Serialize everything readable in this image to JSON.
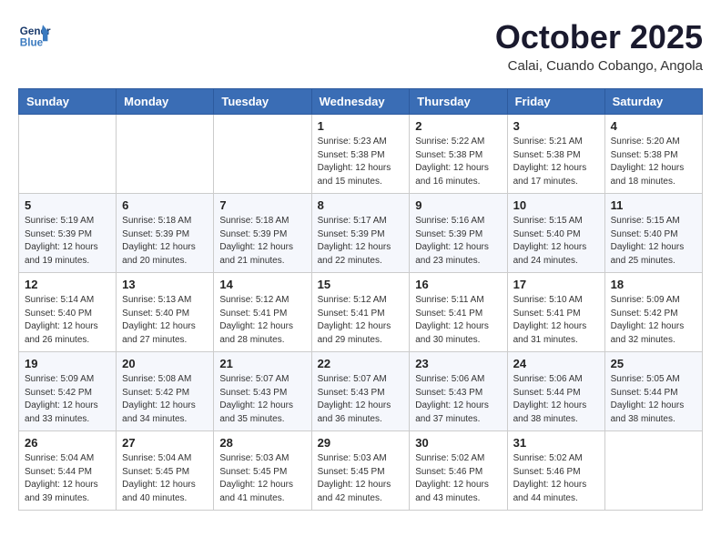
{
  "header": {
    "logo_line1": "General",
    "logo_line2": "Blue",
    "month": "October 2025",
    "location": "Calai, Cuando Cobango, Angola"
  },
  "weekdays": [
    "Sunday",
    "Monday",
    "Tuesday",
    "Wednesday",
    "Thursday",
    "Friday",
    "Saturday"
  ],
  "weeks": [
    [
      {
        "day": "",
        "sunrise": "",
        "sunset": "",
        "daylight": ""
      },
      {
        "day": "",
        "sunrise": "",
        "sunset": "",
        "daylight": ""
      },
      {
        "day": "",
        "sunrise": "",
        "sunset": "",
        "daylight": ""
      },
      {
        "day": "1",
        "sunrise": "Sunrise: 5:23 AM",
        "sunset": "Sunset: 5:38 PM",
        "daylight": "Daylight: 12 hours and 15 minutes."
      },
      {
        "day": "2",
        "sunrise": "Sunrise: 5:22 AM",
        "sunset": "Sunset: 5:38 PM",
        "daylight": "Daylight: 12 hours and 16 minutes."
      },
      {
        "day": "3",
        "sunrise": "Sunrise: 5:21 AM",
        "sunset": "Sunset: 5:38 PM",
        "daylight": "Daylight: 12 hours and 17 minutes."
      },
      {
        "day": "4",
        "sunrise": "Sunrise: 5:20 AM",
        "sunset": "Sunset: 5:38 PM",
        "daylight": "Daylight: 12 hours and 18 minutes."
      }
    ],
    [
      {
        "day": "5",
        "sunrise": "Sunrise: 5:19 AM",
        "sunset": "Sunset: 5:39 PM",
        "daylight": "Daylight: 12 hours and 19 minutes."
      },
      {
        "day": "6",
        "sunrise": "Sunrise: 5:18 AM",
        "sunset": "Sunset: 5:39 PM",
        "daylight": "Daylight: 12 hours and 20 minutes."
      },
      {
        "day": "7",
        "sunrise": "Sunrise: 5:18 AM",
        "sunset": "Sunset: 5:39 PM",
        "daylight": "Daylight: 12 hours and 21 minutes."
      },
      {
        "day": "8",
        "sunrise": "Sunrise: 5:17 AM",
        "sunset": "Sunset: 5:39 PM",
        "daylight": "Daylight: 12 hours and 22 minutes."
      },
      {
        "day": "9",
        "sunrise": "Sunrise: 5:16 AM",
        "sunset": "Sunset: 5:39 PM",
        "daylight": "Daylight: 12 hours and 23 minutes."
      },
      {
        "day": "10",
        "sunrise": "Sunrise: 5:15 AM",
        "sunset": "Sunset: 5:40 PM",
        "daylight": "Daylight: 12 hours and 24 minutes."
      },
      {
        "day": "11",
        "sunrise": "Sunrise: 5:15 AM",
        "sunset": "Sunset: 5:40 PM",
        "daylight": "Daylight: 12 hours and 25 minutes."
      }
    ],
    [
      {
        "day": "12",
        "sunrise": "Sunrise: 5:14 AM",
        "sunset": "Sunset: 5:40 PM",
        "daylight": "Daylight: 12 hours and 26 minutes."
      },
      {
        "day": "13",
        "sunrise": "Sunrise: 5:13 AM",
        "sunset": "Sunset: 5:40 PM",
        "daylight": "Daylight: 12 hours and 27 minutes."
      },
      {
        "day": "14",
        "sunrise": "Sunrise: 5:12 AM",
        "sunset": "Sunset: 5:41 PM",
        "daylight": "Daylight: 12 hours and 28 minutes."
      },
      {
        "day": "15",
        "sunrise": "Sunrise: 5:12 AM",
        "sunset": "Sunset: 5:41 PM",
        "daylight": "Daylight: 12 hours and 29 minutes."
      },
      {
        "day": "16",
        "sunrise": "Sunrise: 5:11 AM",
        "sunset": "Sunset: 5:41 PM",
        "daylight": "Daylight: 12 hours and 30 minutes."
      },
      {
        "day": "17",
        "sunrise": "Sunrise: 5:10 AM",
        "sunset": "Sunset: 5:41 PM",
        "daylight": "Daylight: 12 hours and 31 minutes."
      },
      {
        "day": "18",
        "sunrise": "Sunrise: 5:09 AM",
        "sunset": "Sunset: 5:42 PM",
        "daylight": "Daylight: 12 hours and 32 minutes."
      }
    ],
    [
      {
        "day": "19",
        "sunrise": "Sunrise: 5:09 AM",
        "sunset": "Sunset: 5:42 PM",
        "daylight": "Daylight: 12 hours and 33 minutes."
      },
      {
        "day": "20",
        "sunrise": "Sunrise: 5:08 AM",
        "sunset": "Sunset: 5:42 PM",
        "daylight": "Daylight: 12 hours and 34 minutes."
      },
      {
        "day": "21",
        "sunrise": "Sunrise: 5:07 AM",
        "sunset": "Sunset: 5:43 PM",
        "daylight": "Daylight: 12 hours and 35 minutes."
      },
      {
        "day": "22",
        "sunrise": "Sunrise: 5:07 AM",
        "sunset": "Sunset: 5:43 PM",
        "daylight": "Daylight: 12 hours and 36 minutes."
      },
      {
        "day": "23",
        "sunrise": "Sunrise: 5:06 AM",
        "sunset": "Sunset: 5:43 PM",
        "daylight": "Daylight: 12 hours and 37 minutes."
      },
      {
        "day": "24",
        "sunrise": "Sunrise: 5:06 AM",
        "sunset": "Sunset: 5:44 PM",
        "daylight": "Daylight: 12 hours and 38 minutes."
      },
      {
        "day": "25",
        "sunrise": "Sunrise: 5:05 AM",
        "sunset": "Sunset: 5:44 PM",
        "daylight": "Daylight: 12 hours and 38 minutes."
      }
    ],
    [
      {
        "day": "26",
        "sunrise": "Sunrise: 5:04 AM",
        "sunset": "Sunset: 5:44 PM",
        "daylight": "Daylight: 12 hours and 39 minutes."
      },
      {
        "day": "27",
        "sunrise": "Sunrise: 5:04 AM",
        "sunset": "Sunset: 5:45 PM",
        "daylight": "Daylight: 12 hours and 40 minutes."
      },
      {
        "day": "28",
        "sunrise": "Sunrise: 5:03 AM",
        "sunset": "Sunset: 5:45 PM",
        "daylight": "Daylight: 12 hours and 41 minutes."
      },
      {
        "day": "29",
        "sunrise": "Sunrise: 5:03 AM",
        "sunset": "Sunset: 5:45 PM",
        "daylight": "Daylight: 12 hours and 42 minutes."
      },
      {
        "day": "30",
        "sunrise": "Sunrise: 5:02 AM",
        "sunset": "Sunset: 5:46 PM",
        "daylight": "Daylight: 12 hours and 43 minutes."
      },
      {
        "day": "31",
        "sunrise": "Sunrise: 5:02 AM",
        "sunset": "Sunset: 5:46 PM",
        "daylight": "Daylight: 12 hours and 44 minutes."
      },
      {
        "day": "",
        "sunrise": "",
        "sunset": "",
        "daylight": ""
      }
    ]
  ]
}
